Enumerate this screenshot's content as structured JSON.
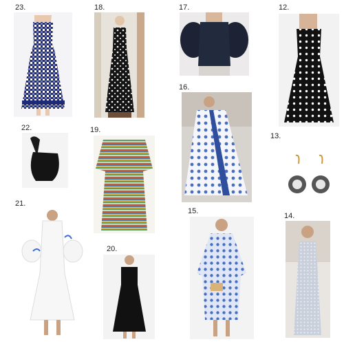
{
  "items": [
    {
      "num": "23.",
      "desc": "navy-gingham-maxi-dress"
    },
    {
      "num": "18.",
      "desc": "black-white-print-maxi-dress"
    },
    {
      "num": "17.",
      "desc": "navy-puff-sleeve-top"
    },
    {
      "num": "12.",
      "desc": "black-polka-dot-dress"
    },
    {
      "num": "16.",
      "desc": "blue-white-print-kaftan"
    },
    {
      "num": "22.",
      "desc": "black-knot-bag"
    },
    {
      "num": "19.",
      "desc": "striped-print-kaftan"
    },
    {
      "num": "13.",
      "desc": "gold-drop-earrings"
    },
    {
      "num": "21.",
      "desc": "white-ruffle-sleeve-dress"
    },
    {
      "num": "15.",
      "desc": "blue-floral-shirt-dress"
    },
    {
      "num": "14.",
      "desc": "silver-sequin-gown"
    },
    {
      "num": "20.",
      "desc": "black-square-neck-dress"
    }
  ],
  "colors": {
    "navy": "#1e2a78",
    "black": "#111111",
    "white": "#ffffff",
    "blue_print": "#4a6fc0"
  }
}
